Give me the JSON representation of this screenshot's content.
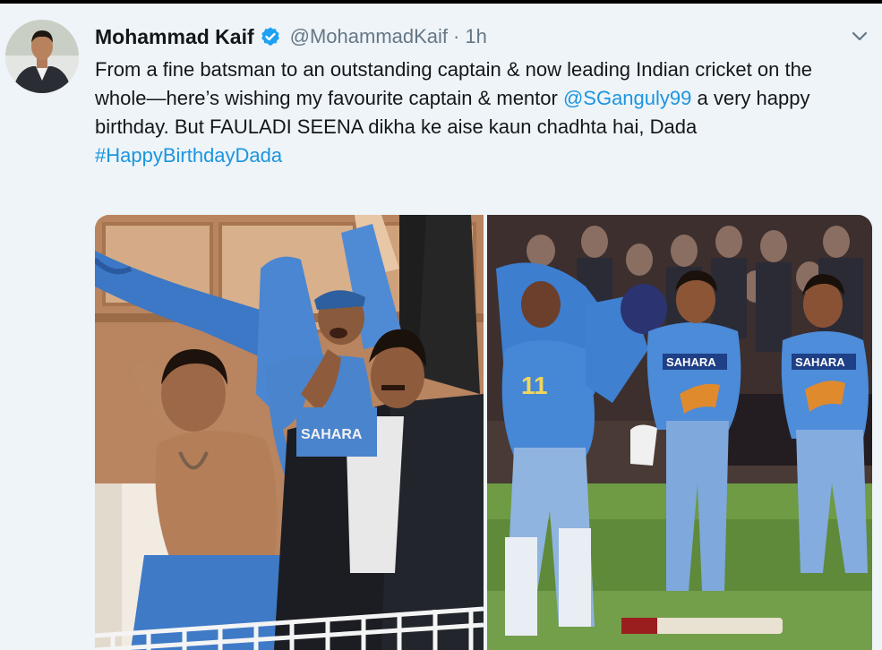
{
  "tweet": {
    "author_name": "Mohammad Kaif",
    "handle": "@MohammadKaif",
    "separator": "·",
    "time": "1h",
    "text_part1": "From a fine batsman to an outstanding captain & now leading Indian cricket on the whole—here’s wishing my favourite captain & mentor ",
    "mention": "@SGanguly99",
    "text_part2": " a very happy birthday. But FAULADI SEENA dikha ke aise kaun chadhta hai, Dada",
    "hashtag": "#HappyBirthdayDada",
    "verified_icon": "verified-badge-icon",
    "more_icon": "chevron-down-icon"
  },
  "colors": {
    "link": "#1b95e0",
    "text": "#14171a",
    "muted": "#657786",
    "background": "#eef4f8"
  },
  "jersey_text": {
    "left": "SAHARA",
    "right_number": "11",
    "right_sponsor_1": "SAHARA",
    "right_sponsor_2": "SAHARA"
  }
}
